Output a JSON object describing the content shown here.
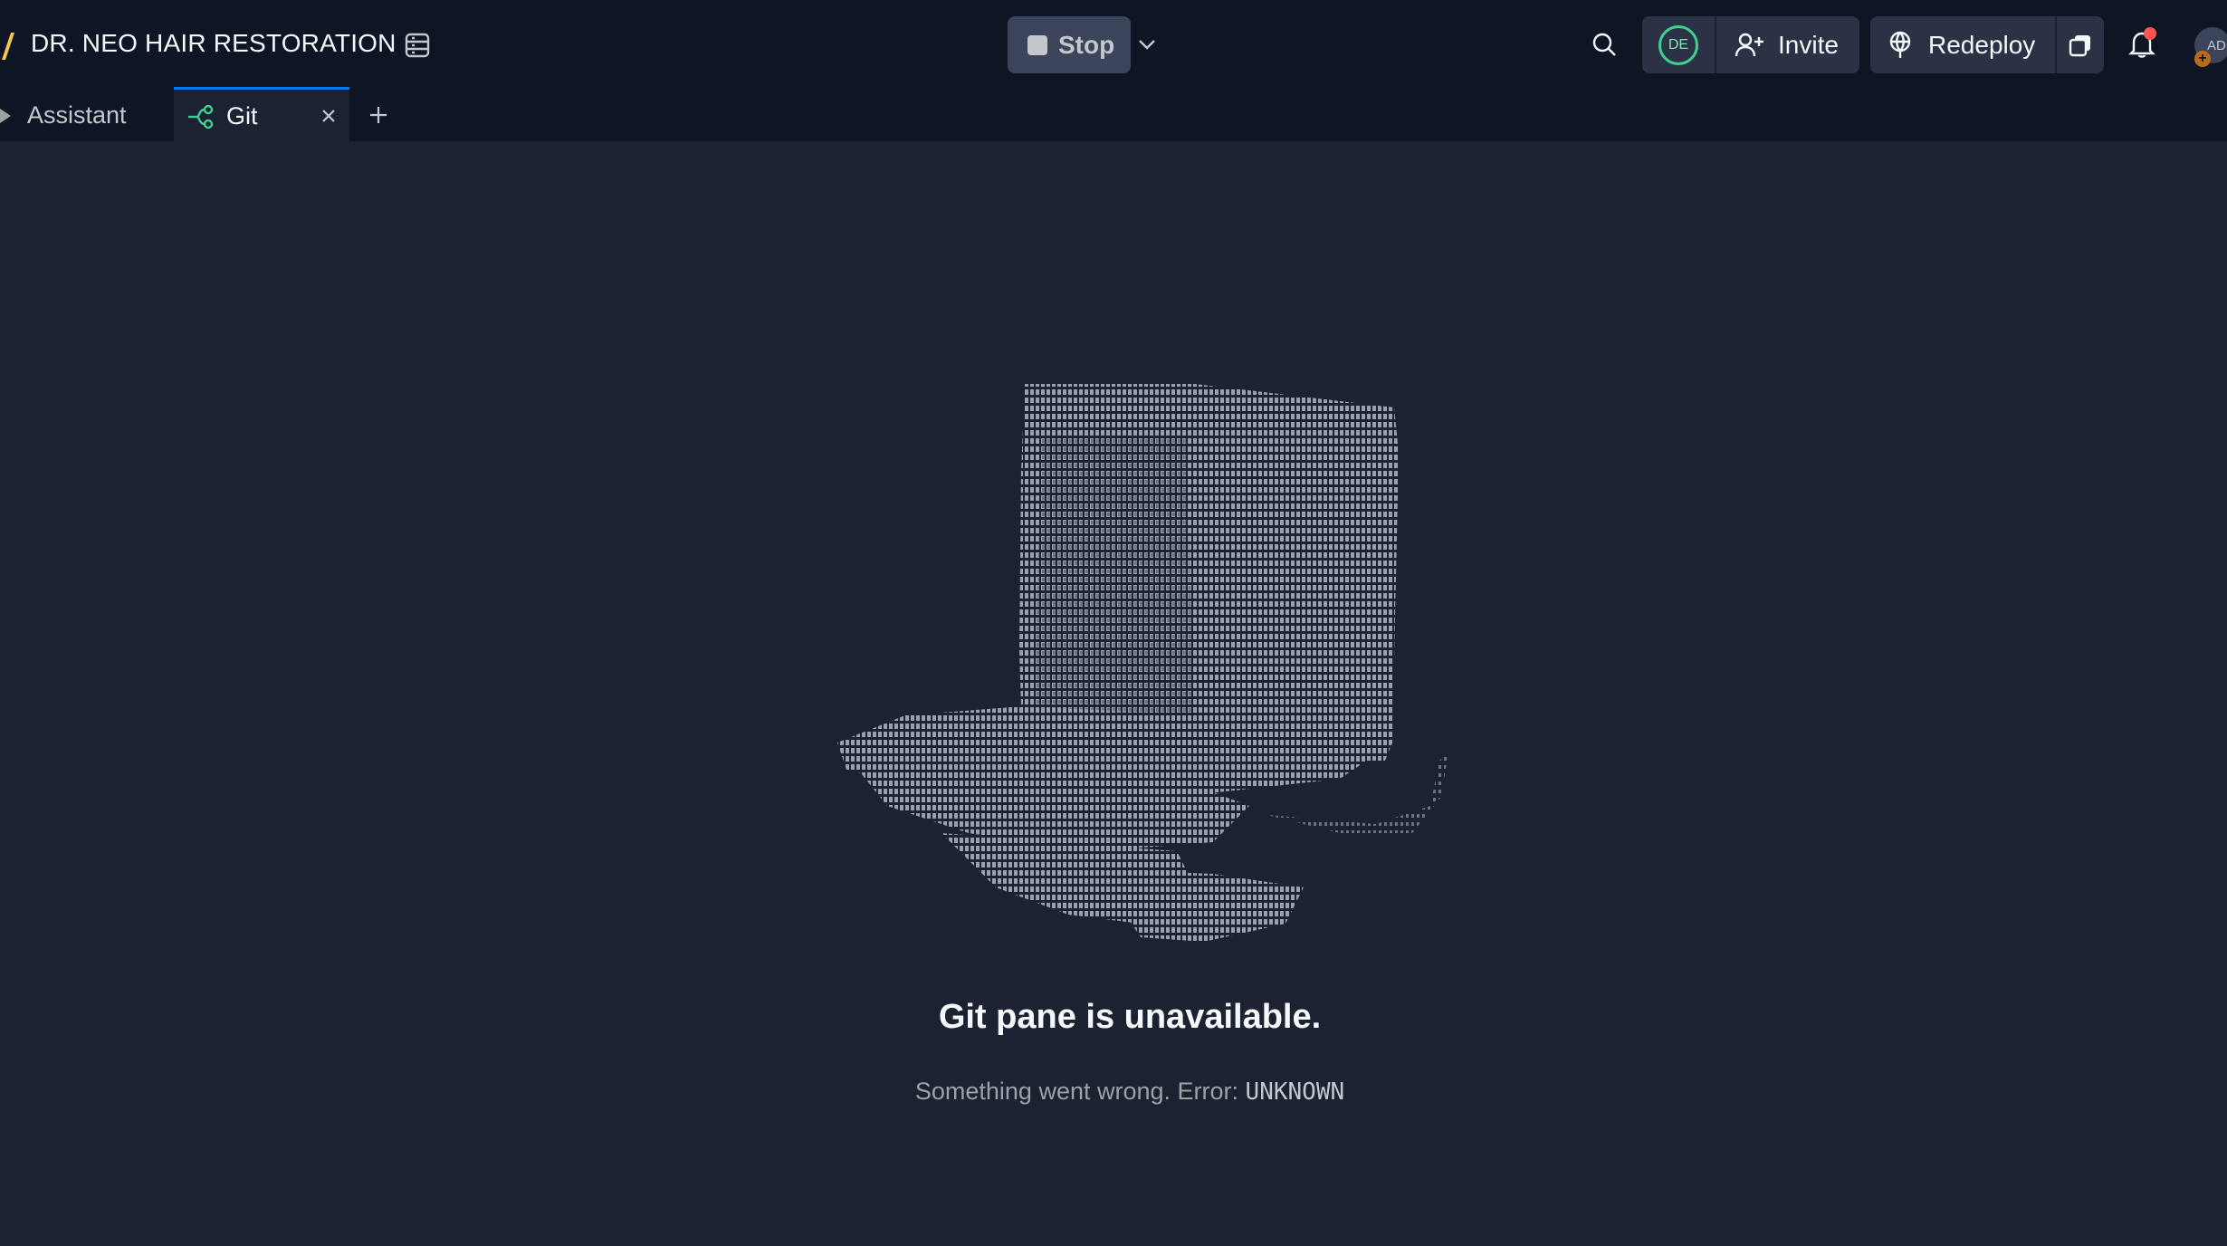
{
  "app": {
    "title": "DR. NEO HAIR RESTORATION",
    "logo_icon": "replit-logo-icon",
    "files_icon": "files-panel-icon"
  },
  "run_control": {
    "stop_label": "Stop",
    "stop_icon": "stop-square-icon",
    "menu_icon": "chevron-down-icon"
  },
  "header": {
    "search_icon": "search-icon",
    "collaborator_initials": "DE",
    "invite_label": "Invite",
    "invite_icon": "user-plus-icon",
    "redeploy_label": "Redeploy",
    "redeploy_icon": "deploy-globe-icon",
    "notifications_icon": "bell-icon",
    "user_initials": "AD",
    "user_badge": "+"
  },
  "tabs": [
    {
      "label": "Assistant",
      "icon": "assistant-icon",
      "active": false
    },
    {
      "label": "Git",
      "icon": "git-branch-icon",
      "active": true,
      "close_icon": "close-icon"
    }
  ],
  "add_tab_icon": "plus-icon",
  "error": {
    "title": "Git pane is unavailable.",
    "message": "Something went wrong. Error:",
    "code": "UNKNOWN",
    "illustration": "ascii-art-top-hat"
  },
  "colors": {
    "background": "#1c2232",
    "topbar": "#0e1525",
    "button": "#2b3245",
    "active_tab_accent": "#0079f2",
    "collaborator_ring": "#3fd08f",
    "notification_dot": "#fd5353"
  }
}
